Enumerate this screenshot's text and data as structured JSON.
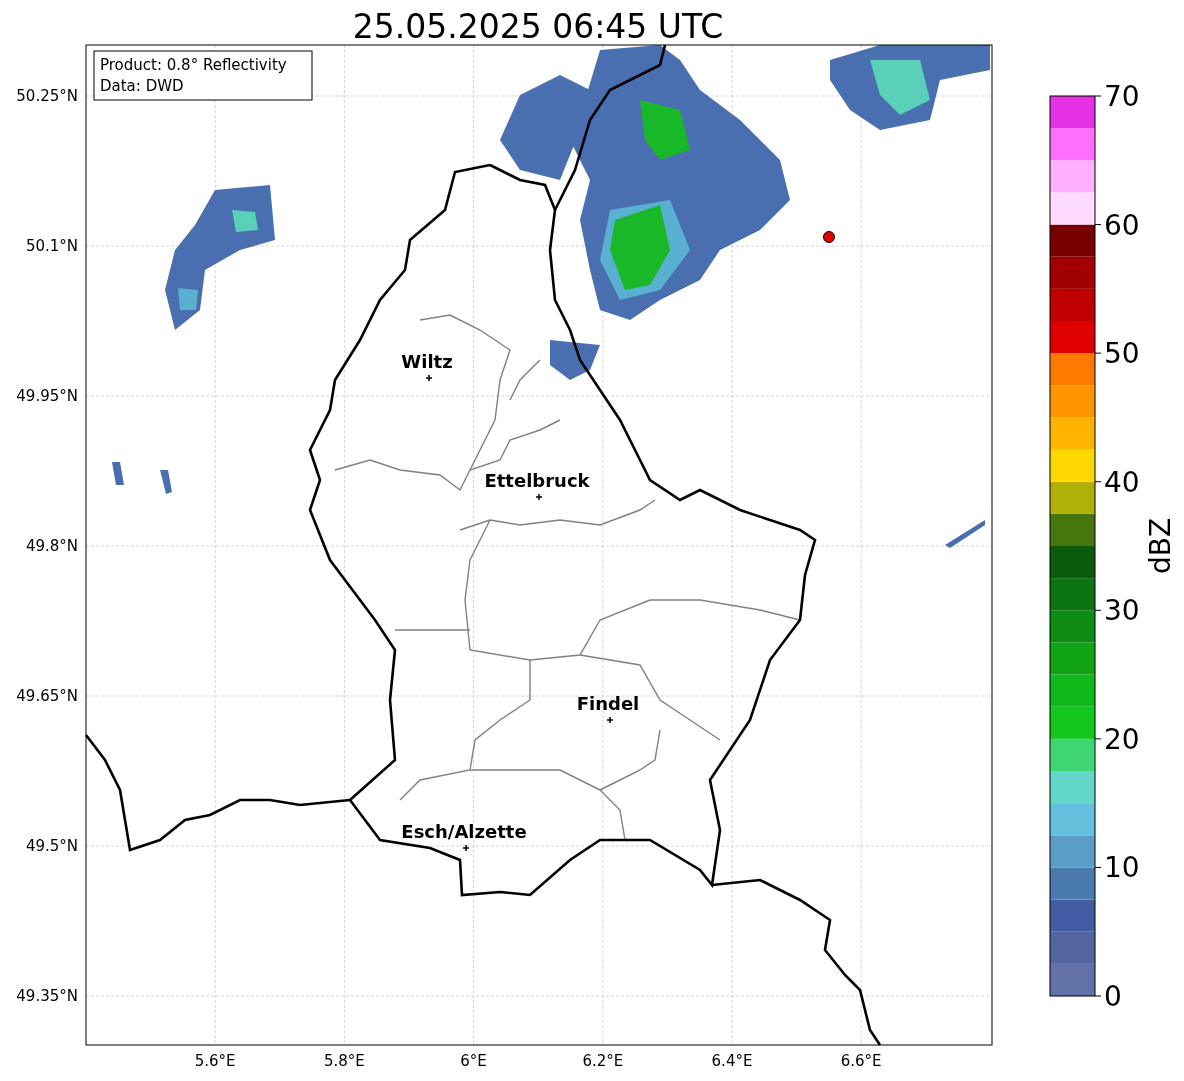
{
  "title": "25.05.2025 06:45 UTC",
  "info_box": [
    "Product: 0.8° Reflectivity",
    "Data: DWD"
  ],
  "map": {
    "x_ticks": [
      "5.6°E",
      "5.8°E",
      "6°E",
      "6.2°E",
      "6.4°E",
      "6.6°E"
    ],
    "y_ticks": [
      "50.25°N",
      "50.1°N",
      "49.95°N",
      "49.8°N",
      "49.65°N",
      "49.5°N",
      "49.35°N"
    ],
    "cities": [
      {
        "name": "Wiltz"
      },
      {
        "name": "Ettelbruck"
      },
      {
        "name": "Findel"
      },
      {
        "name": "Esch/Alzette"
      }
    ]
  },
  "colorbar": {
    "label": "dBZ",
    "ticks": [
      "70",
      "60",
      "50",
      "40",
      "30",
      "20",
      "10",
      "0"
    ],
    "segments": [
      {
        "color": "#6272a8"
      },
      {
        "color": "#52659e"
      },
      {
        "color": "#425da3"
      },
      {
        "color": "#4a7ab0"
      },
      {
        "color": "#5a9ec8"
      },
      {
        "color": "#64c0dc"
      },
      {
        "color": "#64d8c8"
      },
      {
        "color": "#3ed672"
      },
      {
        "color": "#12c81e"
      },
      {
        "color": "#10b81a"
      },
      {
        "color": "#10a416"
      },
      {
        "color": "#0e8c14"
      },
      {
        "color": "#0c7410"
      },
      {
        "color": "#0a5c0c"
      },
      {
        "color": "#46760c"
      },
      {
        "color": "#b0b008"
      },
      {
        "color": "#ffd700"
      },
      {
        "color": "#ffb400"
      },
      {
        "color": "#ff9600"
      },
      {
        "color": "#ff7800"
      },
      {
        "color": "#e00000"
      },
      {
        "color": "#c00000"
      },
      {
        "color": "#a00000"
      },
      {
        "color": "#780000"
      },
      {
        "color": "#ffdcff"
      },
      {
        "color": "#ffb0ff"
      },
      {
        "color": "#ff6eff"
      },
      {
        "color": "#e632e6"
      }
    ]
  }
}
